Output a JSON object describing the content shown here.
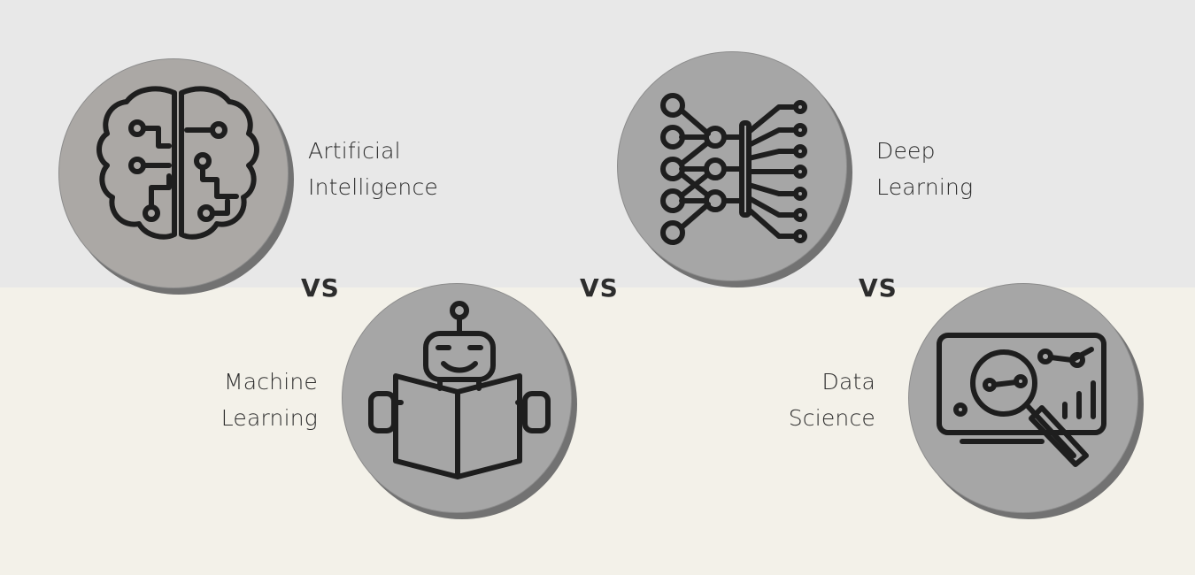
{
  "concepts": {
    "ai": {
      "line1": "Artificial",
      "line2": "Intelligence",
      "icon": "brain-circuit-icon"
    },
    "dl": {
      "line1": "Deep",
      "line2": "Learning",
      "icon": "neural-network-icon"
    },
    "ml": {
      "line1": "Machine",
      "line2": "Learning",
      "icon": "robot-reading-book-icon"
    },
    "ds": {
      "line1": "Data",
      "line2": "Science",
      "icon": "magnifier-chart-icon"
    }
  },
  "separators": {
    "vs1": "VS",
    "vs2": "VS",
    "vs3": "VS"
  },
  "colors": {
    "top_band": "#e8e8e8",
    "bottom_band": "#f3f1e9",
    "circle": "#a6a6a6",
    "circle_shadow": "#727272",
    "icon_stroke": "#1e1e1e"
  }
}
